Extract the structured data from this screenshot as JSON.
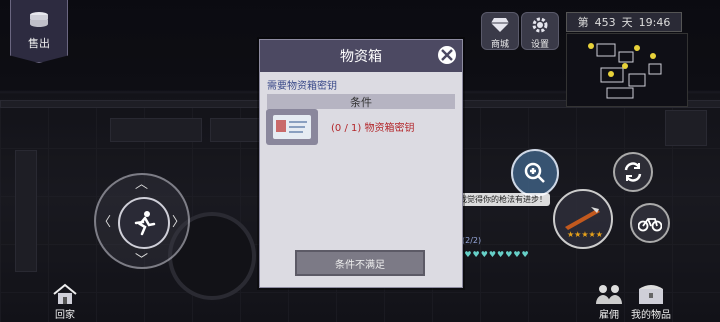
{
  "hud": {
    "sell_label": "售出",
    "shop_label": "商城",
    "settings_label": "设置",
    "day_prefix": "第",
    "day_number": "453",
    "day_suffix": "天",
    "time": "19:46",
    "home_label": "回家",
    "hire_label": "雇佣",
    "my_items_label": "我的物品"
  },
  "world": {
    "npc_speech": "我觉得你的枪法有进步！",
    "npc_level_tag": "(2/2)",
    "weapon_stars": 5
  },
  "modal": {
    "title": "物资箱",
    "requirement_text": "需要物资箱密钥",
    "conditions_header": "条件",
    "condition_progress": "(0 / 1)",
    "condition_item": "物资箱密钥",
    "action_button": "条件不满足"
  },
  "colors": {
    "modal_header": "#4c4962",
    "condition_unmet": "#b3262a",
    "requirement_text": "#3a4a8a"
  }
}
